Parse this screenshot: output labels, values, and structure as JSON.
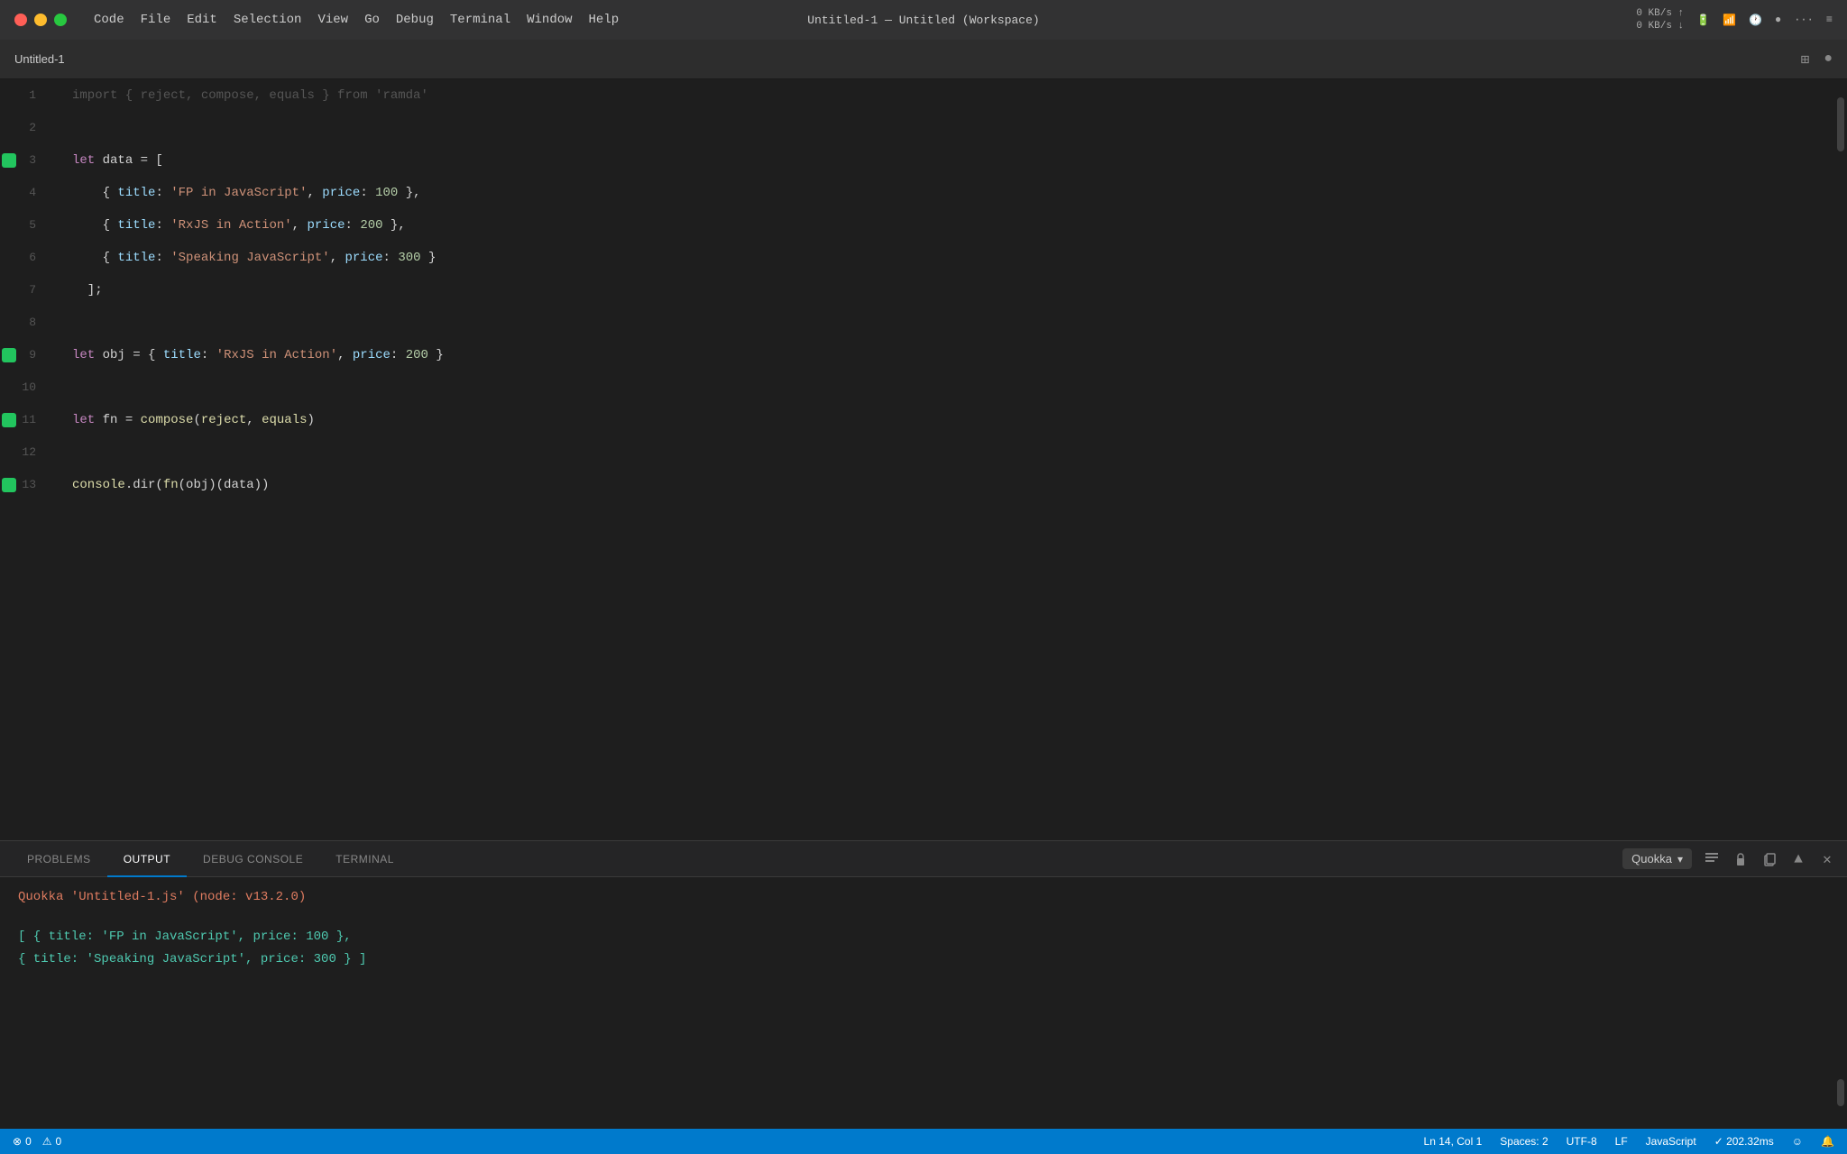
{
  "titlebar": {
    "apple_menu": "",
    "menu_items": [
      "Code",
      "File",
      "Edit",
      "Selection",
      "View",
      "Go",
      "Debug",
      "Terminal",
      "Window",
      "Help"
    ],
    "center_title": "Untitled-1 — Untitled (Workspace)",
    "network_speed": "0 KB/s\n0 KB/s"
  },
  "tabbar": {
    "tab_title": "Untitled-1",
    "split_icon": "⊞",
    "circle_icon": "●"
  },
  "editor": {
    "lines": [
      {
        "num": "1",
        "has_dot": false,
        "code_html": "<span class='comment-fade'>import { reject, compose, equals } from 'ramda'</span>"
      },
      {
        "num": "2",
        "has_dot": false,
        "code_html": ""
      },
      {
        "num": "3",
        "has_dot": true,
        "code_html": "<span class='kw'>let</span> <span class='plain'>data = [</span>"
      },
      {
        "num": "4",
        "has_dot": false,
        "code_html": "<span class='plain'>  { </span><span class='obj-key'>title</span><span class='plain'>: </span><span class='str'>'FP in JavaScript'</span><span class='plain'>, </span><span class='obj-key'>price</span><span class='plain'>: </span><span class='num'>100</span><span class='plain'> },</span>"
      },
      {
        "num": "5",
        "has_dot": false,
        "code_html": "<span class='plain'>  { </span><span class='obj-key'>title</span><span class='plain'>: </span><span class='str'>'RxJS in Action'</span><span class='plain'>, </span><span class='obj-key'>price</span><span class='plain'>: </span><span class='num'>200</span><span class='plain'> },</span>"
      },
      {
        "num": "6",
        "has_dot": false,
        "code_html": "<span class='plain'>  { </span><span class='obj-key'>title</span><span class='plain'>: </span><span class='str'>'Speaking JavaScript'</span><span class='plain'>, </span><span class='obj-key'>price</span><span class='plain'>: </span><span class='num'>300</span><span class='plain'> }</span>"
      },
      {
        "num": "7",
        "has_dot": false,
        "code_html": "<span class='plain'>];</span>"
      },
      {
        "num": "8",
        "has_dot": false,
        "code_html": ""
      },
      {
        "num": "9",
        "has_dot": true,
        "code_html": "<span class='kw'>let</span> <span class='plain'>obj = { </span><span class='obj-key'>title</span><span class='plain'>: </span><span class='str'>'RxJS in Action'</span><span class='plain'>, </span><span class='obj-key'>price</span><span class='plain'>: </span><span class='num'>200</span><span class='plain'> }</span>"
      },
      {
        "num": "10",
        "has_dot": false,
        "code_html": ""
      },
      {
        "num": "11",
        "has_dot": true,
        "code_html": "<span class='kw'>let</span> <span class='plain'>fn = </span><span class='fn-name'>compose</span><span class='plain'>(</span><span class='fn-name'>reject</span><span class='plain'>, </span><span class='fn-name'>equals</span><span class='plain'>)</span>"
      },
      {
        "num": "12",
        "has_dot": false,
        "code_html": ""
      },
      {
        "num": "13",
        "has_dot": true,
        "code_html": "<span class='fn-name'>console</span><span class='plain'>.dir(</span><span class='fn-name'>fn</span><span class='plain'>(obj)(data))</span>"
      }
    ]
  },
  "panel": {
    "tabs": [
      "PROBLEMS",
      "OUTPUT",
      "DEBUG CONSOLE",
      "TERMINAL"
    ],
    "active_tab": "OUTPUT",
    "dropdown_label": "Quokka",
    "quokka_header": "Quokka 'Untitled-1.js' (node: v13.2.0)",
    "output_line1": "[ { title: 'FP in JavaScript', price: 100 },",
    "output_line2": "  { title: 'Speaking JavaScript', price: 300 } ]"
  },
  "statusbar": {
    "errors": "⊗ 0",
    "warnings": "⚠ 0",
    "position": "Ln 14, Col 1",
    "spaces": "Spaces: 2",
    "encoding": "UTF-8",
    "line_ending": "LF",
    "language": "JavaScript",
    "timing": "✓ 202.32ms",
    "smiley": "☺",
    "bell": "🔔"
  }
}
